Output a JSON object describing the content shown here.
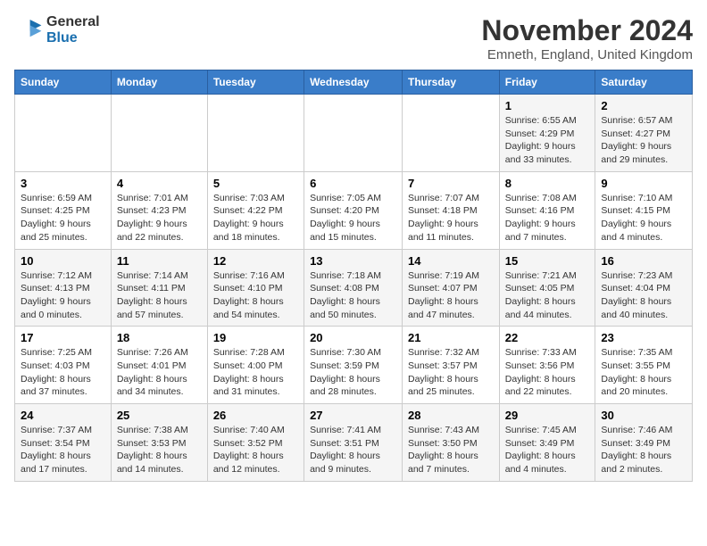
{
  "header": {
    "logo_line1": "General",
    "logo_line2": "Blue",
    "month_title": "November 2024",
    "location": "Emneth, England, United Kingdom"
  },
  "weekdays": [
    "Sunday",
    "Monday",
    "Tuesday",
    "Wednesday",
    "Thursday",
    "Friday",
    "Saturday"
  ],
  "weeks": [
    [
      {
        "day": "",
        "info": ""
      },
      {
        "day": "",
        "info": ""
      },
      {
        "day": "",
        "info": ""
      },
      {
        "day": "",
        "info": ""
      },
      {
        "day": "",
        "info": ""
      },
      {
        "day": "1",
        "info": "Sunrise: 6:55 AM\nSunset: 4:29 PM\nDaylight: 9 hours and 33 minutes."
      },
      {
        "day": "2",
        "info": "Sunrise: 6:57 AM\nSunset: 4:27 PM\nDaylight: 9 hours and 29 minutes."
      }
    ],
    [
      {
        "day": "3",
        "info": "Sunrise: 6:59 AM\nSunset: 4:25 PM\nDaylight: 9 hours and 25 minutes."
      },
      {
        "day": "4",
        "info": "Sunrise: 7:01 AM\nSunset: 4:23 PM\nDaylight: 9 hours and 22 minutes."
      },
      {
        "day": "5",
        "info": "Sunrise: 7:03 AM\nSunset: 4:22 PM\nDaylight: 9 hours and 18 minutes."
      },
      {
        "day": "6",
        "info": "Sunrise: 7:05 AM\nSunset: 4:20 PM\nDaylight: 9 hours and 15 minutes."
      },
      {
        "day": "7",
        "info": "Sunrise: 7:07 AM\nSunset: 4:18 PM\nDaylight: 9 hours and 11 minutes."
      },
      {
        "day": "8",
        "info": "Sunrise: 7:08 AM\nSunset: 4:16 PM\nDaylight: 9 hours and 7 minutes."
      },
      {
        "day": "9",
        "info": "Sunrise: 7:10 AM\nSunset: 4:15 PM\nDaylight: 9 hours and 4 minutes."
      }
    ],
    [
      {
        "day": "10",
        "info": "Sunrise: 7:12 AM\nSunset: 4:13 PM\nDaylight: 9 hours and 0 minutes."
      },
      {
        "day": "11",
        "info": "Sunrise: 7:14 AM\nSunset: 4:11 PM\nDaylight: 8 hours and 57 minutes."
      },
      {
        "day": "12",
        "info": "Sunrise: 7:16 AM\nSunset: 4:10 PM\nDaylight: 8 hours and 54 minutes."
      },
      {
        "day": "13",
        "info": "Sunrise: 7:18 AM\nSunset: 4:08 PM\nDaylight: 8 hours and 50 minutes."
      },
      {
        "day": "14",
        "info": "Sunrise: 7:19 AM\nSunset: 4:07 PM\nDaylight: 8 hours and 47 minutes."
      },
      {
        "day": "15",
        "info": "Sunrise: 7:21 AM\nSunset: 4:05 PM\nDaylight: 8 hours and 44 minutes."
      },
      {
        "day": "16",
        "info": "Sunrise: 7:23 AM\nSunset: 4:04 PM\nDaylight: 8 hours and 40 minutes."
      }
    ],
    [
      {
        "day": "17",
        "info": "Sunrise: 7:25 AM\nSunset: 4:03 PM\nDaylight: 8 hours and 37 minutes."
      },
      {
        "day": "18",
        "info": "Sunrise: 7:26 AM\nSunset: 4:01 PM\nDaylight: 8 hours and 34 minutes."
      },
      {
        "day": "19",
        "info": "Sunrise: 7:28 AM\nSunset: 4:00 PM\nDaylight: 8 hours and 31 minutes."
      },
      {
        "day": "20",
        "info": "Sunrise: 7:30 AM\nSunset: 3:59 PM\nDaylight: 8 hours and 28 minutes."
      },
      {
        "day": "21",
        "info": "Sunrise: 7:32 AM\nSunset: 3:57 PM\nDaylight: 8 hours and 25 minutes."
      },
      {
        "day": "22",
        "info": "Sunrise: 7:33 AM\nSunset: 3:56 PM\nDaylight: 8 hours and 22 minutes."
      },
      {
        "day": "23",
        "info": "Sunrise: 7:35 AM\nSunset: 3:55 PM\nDaylight: 8 hours and 20 minutes."
      }
    ],
    [
      {
        "day": "24",
        "info": "Sunrise: 7:37 AM\nSunset: 3:54 PM\nDaylight: 8 hours and 17 minutes."
      },
      {
        "day": "25",
        "info": "Sunrise: 7:38 AM\nSunset: 3:53 PM\nDaylight: 8 hours and 14 minutes."
      },
      {
        "day": "26",
        "info": "Sunrise: 7:40 AM\nSunset: 3:52 PM\nDaylight: 8 hours and 12 minutes."
      },
      {
        "day": "27",
        "info": "Sunrise: 7:41 AM\nSunset: 3:51 PM\nDaylight: 8 hours and 9 minutes."
      },
      {
        "day": "28",
        "info": "Sunrise: 7:43 AM\nSunset: 3:50 PM\nDaylight: 8 hours and 7 minutes."
      },
      {
        "day": "29",
        "info": "Sunrise: 7:45 AM\nSunset: 3:49 PM\nDaylight: 8 hours and 4 minutes."
      },
      {
        "day": "30",
        "info": "Sunrise: 7:46 AM\nSunset: 3:49 PM\nDaylight: 8 hours and 2 minutes."
      }
    ]
  ]
}
